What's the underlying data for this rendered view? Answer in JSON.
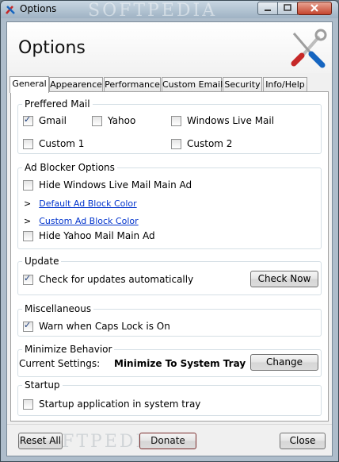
{
  "window": {
    "title": "Options",
    "watermark": "SOFTPEDIA"
  },
  "header": {
    "title": "Options"
  },
  "tabs": [
    {
      "label": "General",
      "active": true
    },
    {
      "label": "Appearence",
      "active": false
    },
    {
      "label": "Performance",
      "active": false
    },
    {
      "label": "Custom Email",
      "active": false
    },
    {
      "label": "Security",
      "active": false
    },
    {
      "label": "Info/Help",
      "active": false
    }
  ],
  "preferred_mail": {
    "legend": "Preffered Mail",
    "options": [
      {
        "label": "Gmail",
        "checked": true
      },
      {
        "label": "Yahoo",
        "checked": false
      },
      {
        "label": "Windows Live Mail",
        "checked": false
      },
      {
        "label": "Custom 1",
        "checked": false
      },
      {
        "label": "Custom 2",
        "checked": false
      }
    ]
  },
  "ad_blocker": {
    "legend": "Ad Blocker Options",
    "hide_wlm": {
      "label": "Hide Windows Live Mail Main Ad",
      "checked": false
    },
    "default_link": {
      "arrow": ">",
      "label": "Default Ad Block Color"
    },
    "custom_link": {
      "arrow": ">",
      "label": "Custom Ad Block Color"
    },
    "hide_yahoo": {
      "label": "Hide Yahoo Mail Main Ad",
      "checked": false
    }
  },
  "update": {
    "legend": "Update",
    "check": {
      "label": "Check for updates automatically",
      "checked": true
    },
    "button": "Check Now"
  },
  "misc": {
    "legend": "Miscellaneous",
    "caps": {
      "label": "Warn when Caps Lock is On",
      "checked": true
    }
  },
  "minimize": {
    "legend": "Minimize Behavior",
    "label": "Current Settings:",
    "value": "Minimize To System Tray",
    "button": "Change"
  },
  "startup": {
    "legend": "Startup",
    "check": {
      "label": "Startup application in system tray",
      "checked": false
    }
  },
  "footer": {
    "reset": "Reset All",
    "donate": "Donate",
    "close": "Close"
  }
}
